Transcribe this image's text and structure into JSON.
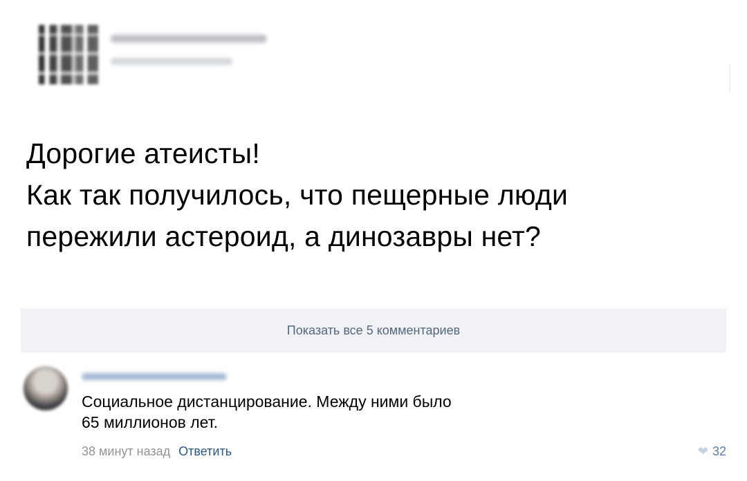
{
  "post": {
    "text_lines": [
      "Дорогие атеисты!",
      "Как так получилось, что пещерные люди",
      "пережили астероид, а динозавры нет?"
    ]
  },
  "comments_bar": {
    "label": "Показать все 5 комментариев"
  },
  "comment": {
    "text_lines": [
      "Социальное дистанцирование. Между ними было",
      "65 миллионов лет."
    ],
    "time": "38 минут назад",
    "reply_label": "Ответить",
    "likes": "32",
    "like_icon": "heart-icon"
  },
  "colors": {
    "link": "#2a5885",
    "muted": "#939393",
    "bar_bg": "#f0f2f5",
    "bar_text": "#55677d"
  }
}
